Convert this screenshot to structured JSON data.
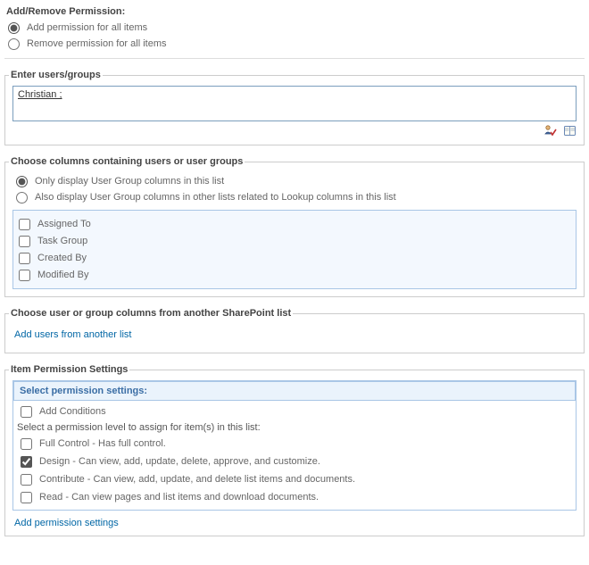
{
  "addRemove": {
    "title": "Add/Remove Permission:",
    "add_label": "Add permission for all items",
    "remove_label": "Remove permission for all items",
    "selected": "add"
  },
  "usersGroups": {
    "legend": "Enter users/groups",
    "value": "Christian ;"
  },
  "columns": {
    "legend": "Choose columns containing users or user groups",
    "only_label": "Only display User Group columns in this list",
    "also_label": "Also display User Group columns in other lists related to Lookup columns in this list",
    "items": [
      {
        "label": "Assigned To",
        "checked": false
      },
      {
        "label": "Task Group",
        "checked": false
      },
      {
        "label": "Created By",
        "checked": false
      },
      {
        "label": "Modified By",
        "checked": false
      }
    ]
  },
  "anotherList": {
    "legend": "Choose user or group columns from another SharePoint list",
    "link": "Add users from another list"
  },
  "itemPerm": {
    "legend": "Item Permission Settings",
    "select_header": "Select permission settings:",
    "add_conditions": "Add Conditions",
    "subtitle": "Select a permission level to assign for item(s) in this list:",
    "levels": [
      {
        "label": "Full Control - Has full control.",
        "checked": false
      },
      {
        "label": "Design - Can view, add, update, delete, approve, and customize.",
        "checked": true
      },
      {
        "label": "Contribute - Can view, add, update, and delete list items and documents.",
        "checked": false
      },
      {
        "label": "Read - Can view pages and list items and download documents.",
        "checked": false
      }
    ],
    "add_link": "Add permission settings"
  }
}
